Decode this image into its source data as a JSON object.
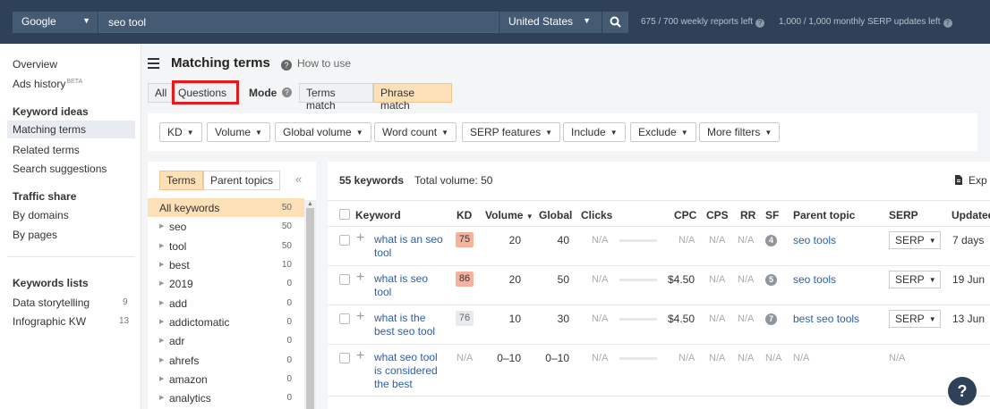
{
  "topbar": {
    "engine": "Google",
    "query": "seo tool",
    "country": "United States",
    "weekly_quota": "675 / 700 weekly reports left",
    "monthly_quota": "1,000 / 1,000 monthly SERP updates left"
  },
  "nav": {
    "overview": "Overview",
    "ads_history": "Ads history",
    "ads_badge": "BETA",
    "keyword_ideas": "Keyword ideas",
    "matching_terms": "Matching terms",
    "related_terms": "Related terms",
    "search_suggestions": "Search suggestions",
    "traffic_share": "Traffic share",
    "by_domains": "By domains",
    "by_pages": "By pages",
    "keywords_lists": "Keywords lists",
    "lists": [
      {
        "label": "Data storytelling",
        "count": "9"
      },
      {
        "label": "Infographic KW",
        "count": "13"
      }
    ]
  },
  "header": {
    "title": "Matching terms",
    "how_to": "How to use",
    "tab_all": "All",
    "tab_questions": "Questions",
    "mode_label": "Mode",
    "mode_terms": "Terms match",
    "mode_phrase": "Phrase match"
  },
  "filters": [
    "KD",
    "Volume",
    "Global volume",
    "Word count",
    "SERP features",
    "Include",
    "Exclude",
    "More filters"
  ],
  "terms_panel": {
    "tab_terms": "Terms",
    "tab_parent": "Parent topics",
    "collapse": "«",
    "items": [
      {
        "label": "All keywords",
        "count": "50"
      },
      {
        "label": "seo",
        "count": "50"
      },
      {
        "label": "tool",
        "count": "50"
      },
      {
        "label": "best",
        "count": "10"
      },
      {
        "label": "2019",
        "count": "0"
      },
      {
        "label": "add",
        "count": "0"
      },
      {
        "label": "addictomatic",
        "count": "0"
      },
      {
        "label": "adr",
        "count": "0"
      },
      {
        "label": "ahrefs",
        "count": "0"
      },
      {
        "label": "amazon",
        "count": "0"
      },
      {
        "label": "analytics",
        "count": "0"
      }
    ]
  },
  "keywords": {
    "count_label": "55 keywords",
    "total_volume": "Total volume: 50",
    "export": "Exp",
    "columns": {
      "keyword": "Keyword",
      "kd": "KD",
      "volume": "Volume",
      "global": "Global",
      "clicks": "Clicks",
      "cpc": "CPC",
      "cps": "CPS",
      "rr": "RR",
      "sf": "SF",
      "parent_topic": "Parent topic",
      "serp": "SERP",
      "updated": "Updated"
    },
    "rows": [
      {
        "kw1": "what is an seo",
        "kw2": "tool",
        "kw3": "",
        "kd": "75",
        "kd_color": "#f6b29c",
        "volume": "20",
        "global": "40",
        "clicks": "N/A",
        "cpc": "N/A",
        "cps": "N/A",
        "rr": "N/A",
        "sf": "4",
        "parent": "seo tools",
        "serp": "SERP",
        "updated": "7 days"
      },
      {
        "kw1": "what is seo",
        "kw2": "tool",
        "kw3": "",
        "kd": "86",
        "kd_color": "#f6b29c",
        "volume": "20",
        "global": "50",
        "clicks": "N/A",
        "cpc": "$4.50",
        "cps": "N/A",
        "rr": "N/A",
        "sf": "5",
        "parent": "seo tools",
        "serp": "SERP",
        "updated": "19 Jun"
      },
      {
        "kw1": "what is the",
        "kw2": "best seo tool",
        "kw3": "",
        "kd": "76",
        "kd_color": "#e8eaec",
        "volume": "10",
        "global": "30",
        "clicks": "N/A",
        "cpc": "$4.50",
        "cps": "N/A",
        "rr": "N/A",
        "sf": "7",
        "parent": "best seo tools",
        "serp": "SERP",
        "updated": "13 Jun"
      },
      {
        "kw1": "what seo tool",
        "kw2": "is considered",
        "kw3": "the best",
        "kd": "N/A",
        "volume": "0–10",
        "global": "0–10",
        "clicks": "N/A",
        "cpc": "N/A",
        "cps": "N/A",
        "rr": "N/A",
        "sf": "N/A",
        "parent": "N/A",
        "serp": "N/A",
        "updated": ""
      }
    ]
  },
  "help": "?"
}
